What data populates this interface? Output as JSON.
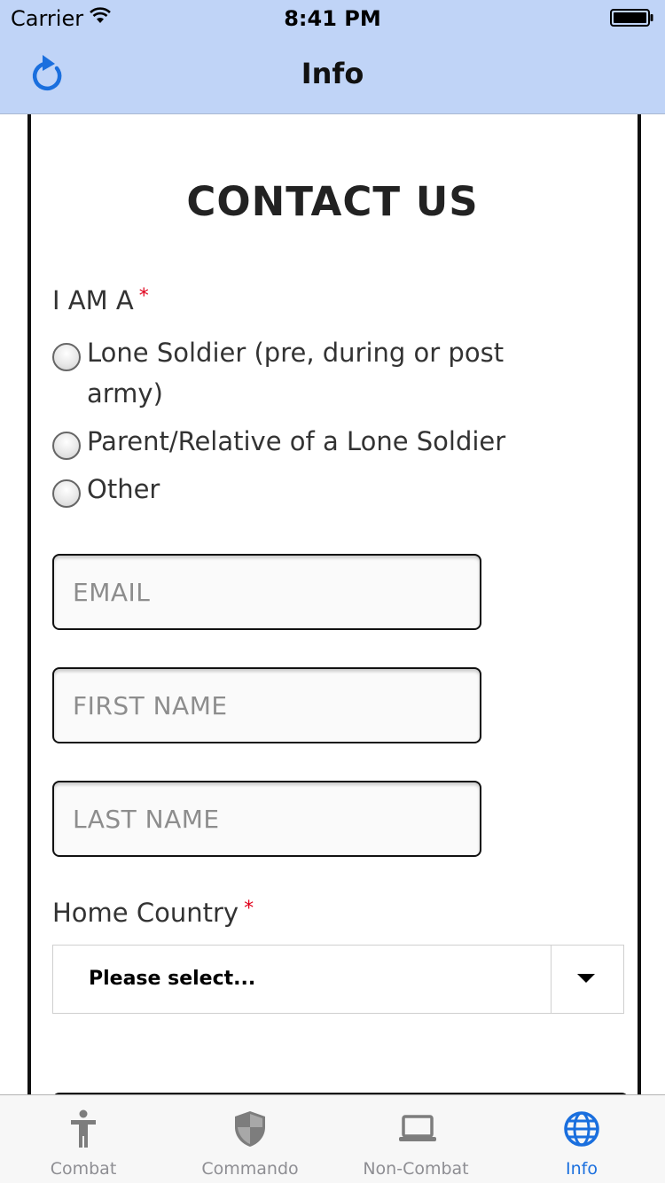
{
  "status_bar": {
    "carrier": "Carrier",
    "time": "8:41 PM"
  },
  "nav_bar": {
    "title": "Info",
    "refresh_icon": "refresh-icon"
  },
  "form": {
    "heading": "CONTACT US",
    "iam_label": "I AM A",
    "required_mark": "*",
    "radio_options": [
      "Lone Soldier (pre, during or post army)",
      "Parent/Relative of a Lone Soldier",
      "Other"
    ],
    "email_placeholder": "EMAIL",
    "first_name_placeholder": "FIRST NAME",
    "last_name_placeholder": "LAST NAME",
    "home_country_label": "Home Country",
    "home_country_value": "Please select..."
  },
  "tab_bar": {
    "tabs": [
      {
        "label": "Combat",
        "icon": "person-icon"
      },
      {
        "label": "Commando",
        "icon": "shield-icon"
      },
      {
        "label": "Non-Combat",
        "icon": "laptop-icon"
      },
      {
        "label": "Info",
        "icon": "globe-icon"
      }
    ],
    "active_color": "#1a6fde",
    "inactive_color": "#8e8e93"
  },
  "colors": {
    "nav_background": "#c0d4f7",
    "required": "#e0001b"
  }
}
